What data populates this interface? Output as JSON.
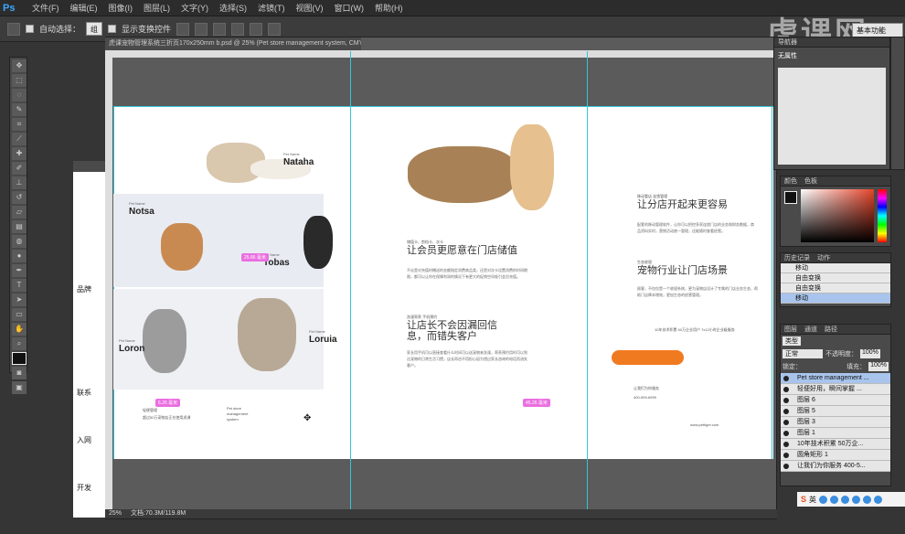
{
  "app": {
    "logo": "Ps"
  },
  "menu": [
    "文件(F)",
    "编辑(E)",
    "图像(I)",
    "图层(L)",
    "文字(Y)",
    "选择(S)",
    "滤镜(T)",
    "视图(V)",
    "窗口(W)",
    "帮助(H)"
  ],
  "options": {
    "auto_select_label": "自动选择：",
    "auto_select_value": "组",
    "show_transform_label": "显示变换控件"
  },
  "brand": "虎课网",
  "workspace": "基本功能",
  "document": {
    "tab_title": "虎课宠物管理系统三折页170x250mm b.psd @ 25% (Pet store management system, CMYK/8) *",
    "zoom": "25%",
    "doc_size": "文档:70.3M/119.8M"
  },
  "bg_doc_side_labels": [
    "品牌",
    "联系",
    "入网",
    "开发"
  ],
  "panel1": {
    "pets": [
      {
        "name": "Nataha",
        "small": "Pet Name"
      },
      {
        "name": "Notsa",
        "small": "Pet Name"
      },
      {
        "name": "Tobas",
        "small": "Pet Name"
      },
      {
        "name": "Loron",
        "small": "Pet Name"
      },
      {
        "name": "Loruia",
        "small": "Pet Name"
      }
    ],
    "tag1": "25.86 毫米",
    "tag2": "6.26 毫米",
    "footer_lines": [
      "轻便管理",
      "超过50万宠物店正在使用虎课"
    ],
    "footer_logo_lines": [
      "Pet store",
      "management",
      "system"
    ]
  },
  "panel2": {
    "sub1": "储值卡、剪档卡、次卡",
    "h1": "让会员更愿意在门店储值",
    "p1": "不论是对充值时赠送的金额指定消费商品类，还是对次卡设置消费的时间期限，都可以让你在保障利润的情况下有更大的促销空间吸引会员充值。",
    "sub2": "洗澡寄养 手机预约",
    "h2": "让店长不会因漏回信息，而错失客户",
    "p2": "家长用手机可以直接查看什么时间可以送宠物来洗澡，寄养预约用时可以到达宠物的日常生活习惯，店长再也不用担心因为错过家长咨询的电话而流失客户。",
    "tag3": "45.26 毫米"
  },
  "panel3": {
    "sub1": "移动看店 连锁管理",
    "h1": "让分店开起来更容易",
    "p1": "配套的移动管理软件，让你可以把控多家连锁门店的业务和财务数据，商品资料实时，营销活动统一管理，还能随时查看经营。",
    "sub2": "生态收银",
    "h2": "宠物行业让门店场景",
    "p2": "顾客，不仅仅是一个收银系统，更为宠物店设计了专属的门店业务生态，帮助门店降本增效，更加生态的经营管理。",
    "stats": "10年技术积累   50万企业用户   7x12小时企业级服务",
    "contact_label": "让我们为你服务",
    "phone": "400-599-6999",
    "website": "www.pettiger.com"
  },
  "navigator": {
    "tab1": "导航器",
    "content": "无属性"
  },
  "color_panel": {
    "tab1": "颜色",
    "tab2": "色板"
  },
  "history": {
    "tabs": [
      "历史记录",
      "动作"
    ],
    "items": [
      "移动",
      "自由变换",
      "自由变换",
      "移动"
    ]
  },
  "layers": {
    "tabs": [
      "图层",
      "通道",
      "路径"
    ],
    "filter_label": "类型",
    "blend_mode": "正常",
    "opacity_label": "不透明度：",
    "opacity": "100%",
    "lock_label": "锁定：",
    "fill_label": "填充：",
    "fill": "100%",
    "items": [
      "Pet store management ...",
      "轻便好用，瞬间掌握 ...",
      "图层 6",
      "图层 5",
      "图层 3",
      "图层 1",
      "10年技术积累   50万企...",
      "圆角矩形 1",
      "让我们为你服务 400-5..."
    ]
  },
  "taskbar": {
    "ime": "英"
  },
  "colors": {
    "accent_orange": "#f07a20",
    "tag_pink": "#ea6fe0",
    "guide": "#34c6d8"
  }
}
